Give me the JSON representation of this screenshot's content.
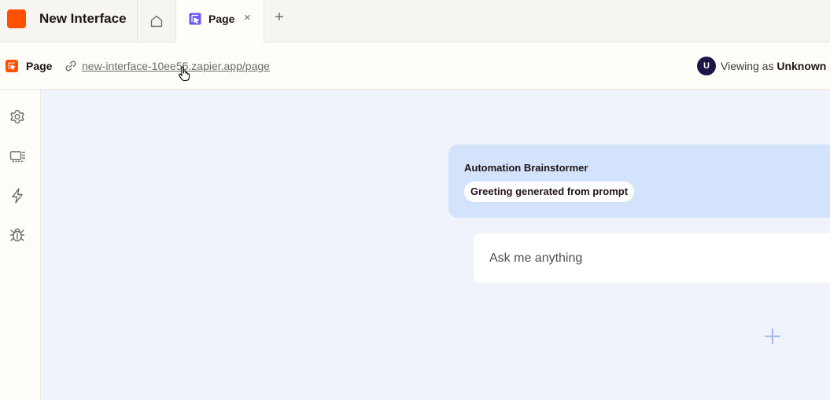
{
  "app": {
    "title": "New Interface",
    "brand_color": "#ff4f00"
  },
  "tabs": [
    {
      "icon": "home-icon"
    },
    {
      "icon": "page-icon",
      "label": "Page",
      "close_glyph": "×",
      "active": true
    }
  ],
  "tab_add_glyph": "+",
  "subbar": {
    "page_label": "Page",
    "url": "new-interface-10ee55.zapier.app/page",
    "viewer": {
      "avatar_initial": "U",
      "prefix": "Viewing as ",
      "name": "Unknown"
    }
  },
  "rail": [
    {
      "icon": "settings-gear-icon"
    },
    {
      "icon": "components-icon"
    },
    {
      "icon": "lightning-icon"
    },
    {
      "icon": "bug-icon"
    }
  ],
  "chatbot": {
    "name": "Automation Brainstormer",
    "greeting": "Greeting generated from prompt",
    "input_placeholder": "Ask me anything"
  }
}
